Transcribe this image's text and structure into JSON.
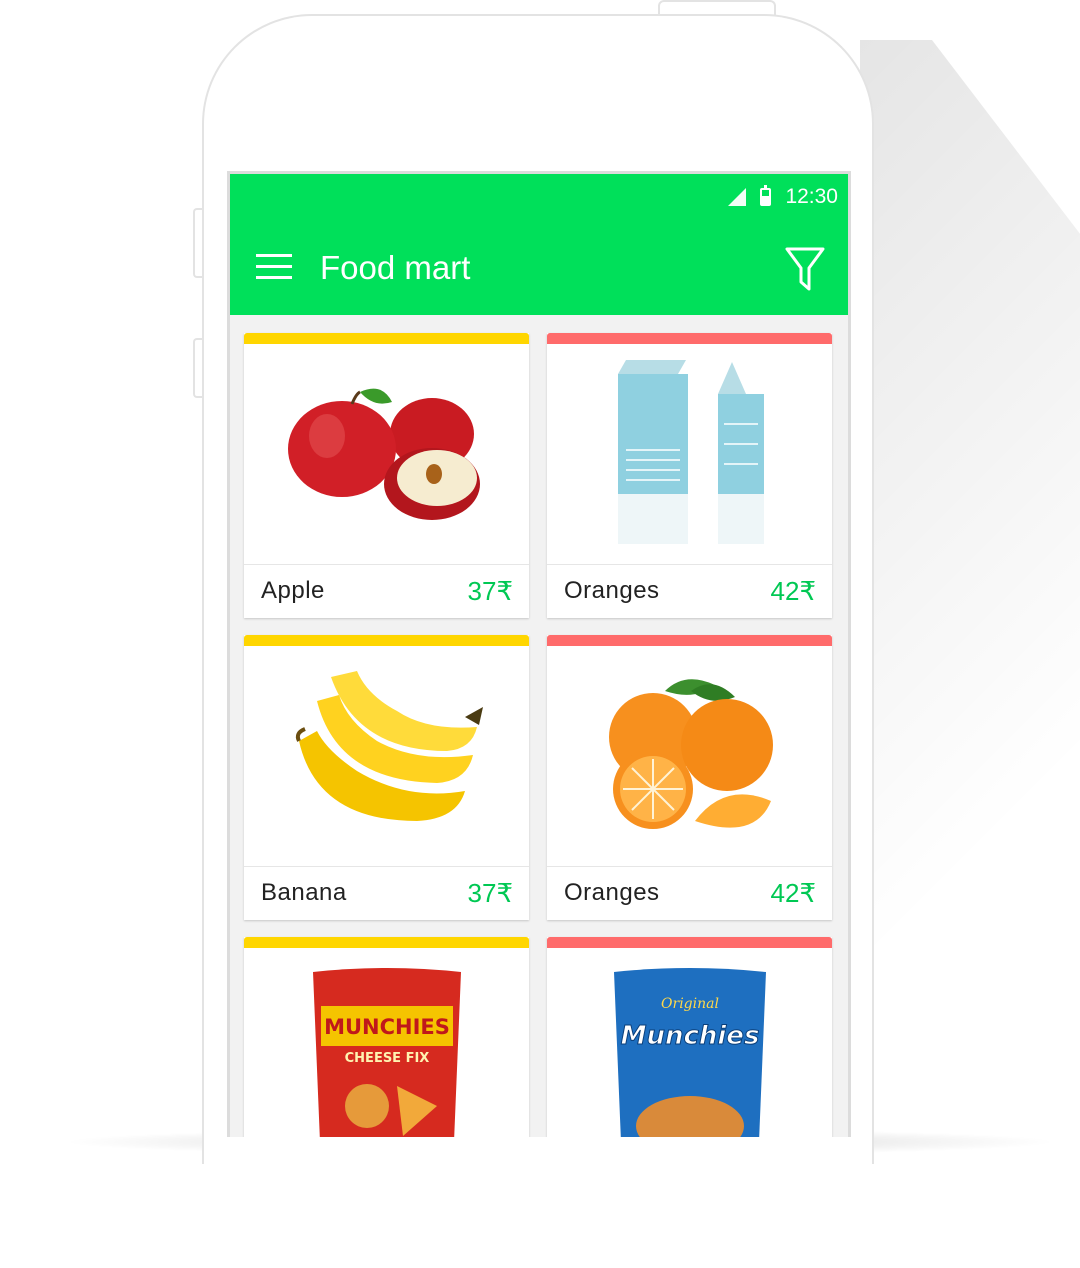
{
  "status_bar": {
    "time": "12:30"
  },
  "app_bar": {
    "title": "Food mart"
  },
  "colors": {
    "accent": "#00e05a",
    "price": "#00c853",
    "stripe_yellow": "#ffd600",
    "stripe_red": "#ff6b6b"
  },
  "products": [
    {
      "name": "Apple",
      "price": "37₹",
      "stripe": "yellow",
      "image": "apples"
    },
    {
      "name": "Oranges",
      "price": "42₹",
      "stripe": "red",
      "image": "milk-cartons"
    },
    {
      "name": "Banana",
      "price": "37₹",
      "stripe": "yellow",
      "image": "bananas"
    },
    {
      "name": "Oranges",
      "price": "42₹",
      "stripe": "red",
      "image": "oranges"
    },
    {
      "name": "",
      "price": "",
      "stripe": "yellow",
      "image": "munchies-cheese-fix-bag",
      "brand": "MUNCHIES",
      "flavor": "CHEESE FIX"
    },
    {
      "name": "",
      "price": "",
      "stripe": "red",
      "image": "munchies-original-bag",
      "brand": "Munchies",
      "flavor": "Original"
    }
  ]
}
